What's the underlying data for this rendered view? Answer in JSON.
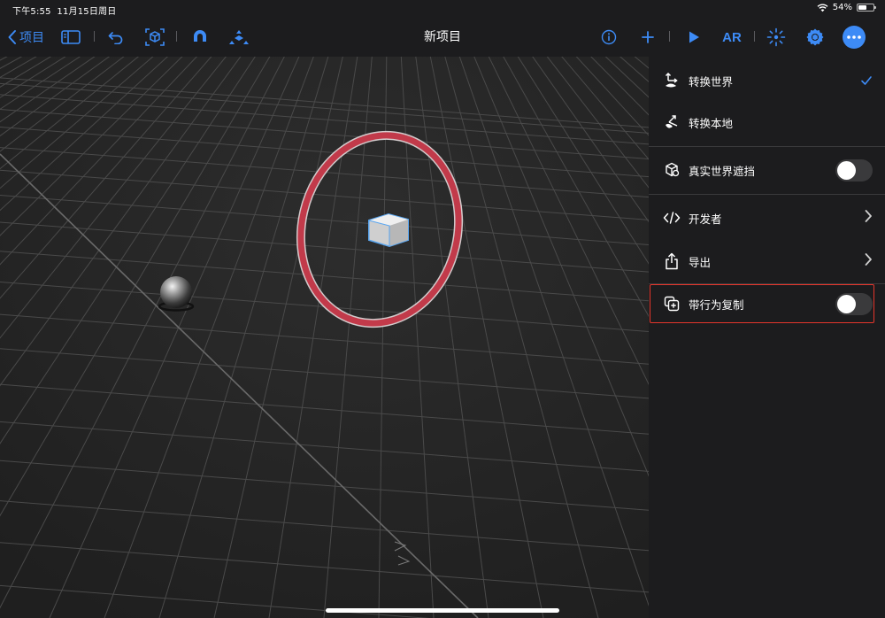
{
  "status": {
    "time": "下午5:55",
    "date": "11月15日周日",
    "battery": "54%",
    "battery_level": 0.54
  },
  "toolbar": {
    "back_label": "项目",
    "title": "新项目",
    "ar_label": "AR",
    "icons": [
      "chevron-left-icon",
      "sidebar-icon",
      "undo-icon",
      "ar-cube-icon",
      "magnet-icon",
      "snap-icon",
      "info-icon",
      "plus-icon",
      "play-icon",
      "ar-icon",
      "anchor-icon",
      "gear-icon",
      "more-icon"
    ]
  },
  "menu": {
    "items": [
      {
        "label": "转换世界",
        "icon": "transform-world-icon",
        "checked": true
      },
      {
        "label": "转换本地",
        "icon": "transform-local-icon"
      },
      {
        "label": "真实世界遮挡",
        "icon": "occlusion-icon",
        "toggle": false
      },
      {
        "label": "开发者",
        "icon": "code-icon",
        "chevron": true
      },
      {
        "label": "导出",
        "icon": "share-icon",
        "chevron": true
      },
      {
        "label": "带行为复制",
        "icon": "duplicate-icon",
        "toggle": false
      }
    ]
  },
  "colors": {
    "accent": "#3d8bf6",
    "ring": "#c23a4a",
    "highlight": "#e5352b",
    "panel": "#1c1c1e",
    "viewport": "#262626"
  }
}
